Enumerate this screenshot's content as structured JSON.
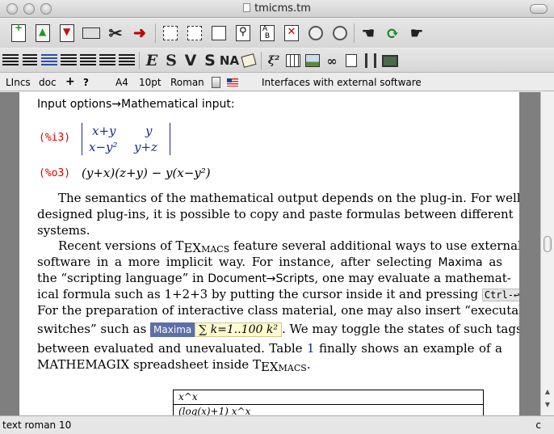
{
  "window": {
    "title": "tmicms.tm"
  },
  "toolbar1": {
    "icons": [
      "new-document-icon",
      "open-document-icon",
      "save-document-icon",
      "print-icon",
      "preferences-icon",
      "export-icon",
      "copy-icon",
      "cut-icon",
      "paste-icon",
      "search-icon",
      "replace-icon",
      "spell-check-icon",
      "undo-icon",
      "redo-icon",
      "back-icon",
      "refresh-icon",
      "forward-icon"
    ]
  },
  "toolbar2": {
    "letters": {
      "e": "E",
      "s": "S",
      "v": "V",
      "s2": "S",
      "na": "NA"
    },
    "icons": [
      "align-left-icon",
      "typewriter-icon",
      "align-center-icon",
      "align-right-icon",
      "list-icon",
      "itemize-icon",
      "tag-icon",
      "formula-icon",
      "table-icon",
      "image-icon",
      "link-icon",
      "duplicate-icon",
      "film-icon",
      "screen-icon"
    ]
  },
  "formatbar": {
    "mode": "LIncs",
    "style": "doc",
    "plus": "+",
    "help": "?",
    "paper": "A4",
    "size": "10pt",
    "font": "Roman",
    "language_flag": "us-flag-icon",
    "focus": "Interfaces with external software"
  },
  "document": {
    "heading": "Input options→Mathematical input:",
    "prompt_in": "(%i3)",
    "prompt_out": "(%o3)",
    "matrix": [
      [
        "x+y",
        "y"
      ],
      [
        "x−y²",
        "y+z"
      ]
    ],
    "output_formula": "(y+x)(z+y) − y(x−y²)",
    "p1": [
      "The semantics of the mathematical output depends on the plug-in. For well-",
      "designed plug-ins, it is possible to copy and paste formulas between different",
      "systems."
    ],
    "p2_line1a": "Recent versions of T",
    "p2_line1b": "EX",
    "p2_line1c": "MACS",
    "p2_line1d": " feature several additional ways to use external",
    "p2_line2a": "software in a more implicit way. For instance, after selecting ",
    "p2_line2b": "Maxima",
    "p2_line2c": " as",
    "p2_line3a": "the “scripting language” in ",
    "p2_line3b": "Document→Scripts",
    "p2_line3c": ", one may evaluate a mathemat-",
    "p2_line4a": "ical formula such as 1+2+3 by putting the cursor inside it and pressing ",
    "p2_line4b": "Ctrl-↩",
    "p2_line4c": ".",
    "p2_line5": "For the preparation of interactive class material, one may also insert “executable",
    "p2_line6a": "switches” such as ",
    "maxima_tag": "Maxima",
    "sum_formula": "∑ k=1..100 k²",
    "p2_line6b": ". We may toggle the states of such tags",
    "p2_line7a": "between evaluated and unevaluated. Table ",
    "p2_line7b": "1",
    "p2_line7c": " finally shows an example of a",
    "p2_line8a": "MATHEMAGIX spreadsheet inside T",
    "p2_line8b": "EX",
    "p2_line8c": "MACS",
    "p2_line8d": ".",
    "table_rows": [
      "x^x",
      "(log(x)+1) x^x"
    ]
  },
  "statusbar": {
    "left": "text roman 10",
    "right": "c"
  }
}
